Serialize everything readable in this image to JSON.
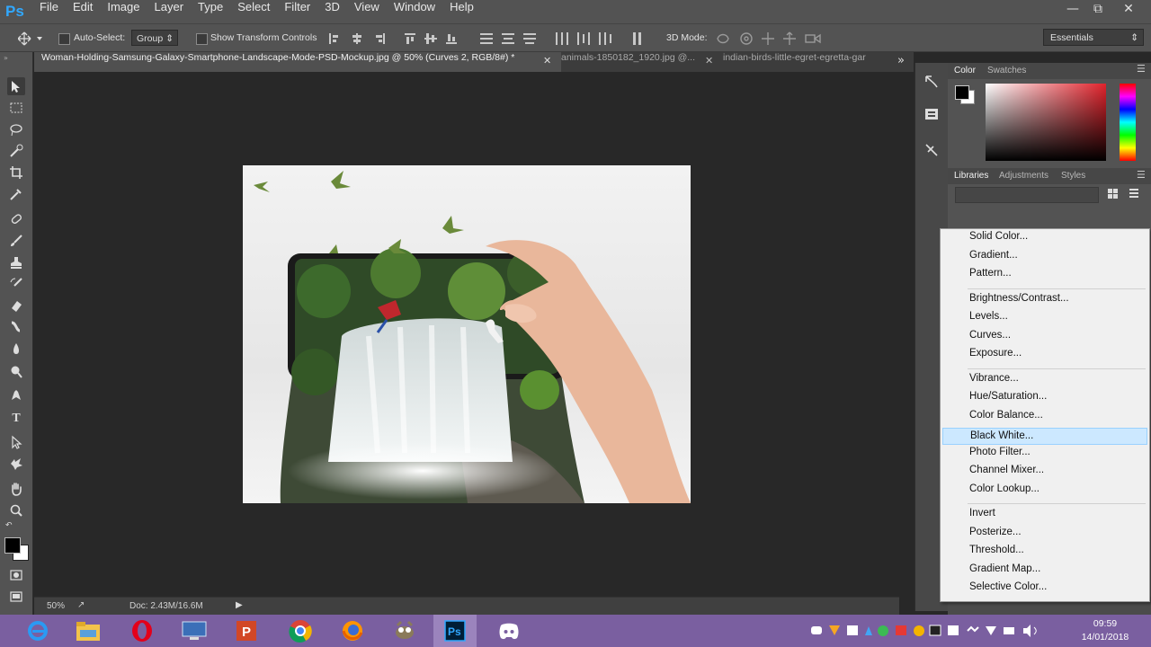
{
  "app": {
    "logo": "Ps",
    "accent": "#31a8ff"
  },
  "window_controls": {
    "minimize": "—",
    "restore": "⧉",
    "close": "✕"
  },
  "menu": [
    "File",
    "Edit",
    "Image",
    "Layer",
    "Type",
    "Select",
    "Filter",
    "3D",
    "View",
    "Window",
    "Help"
  ],
  "options_bar": {
    "auto_select_label": "Auto-Select:",
    "auto_select_value": "Group",
    "transform_label": "Show Transform Controls",
    "mode_label": "3D Mode:",
    "workspace": "Essentials"
  },
  "tabs": [
    {
      "label": "Woman-Holding-Samsung-Galaxy-Smartphone-Landscape-Mode-PSD-Mockup.jpg @ 50% (Curves 2, RGB/8#) *",
      "active": true
    },
    {
      "label": "animals-1850182_1920.jpg @...",
      "active": false
    },
    {
      "label": "indian-birds-little-egret-egretta-gar",
      "active": false
    }
  ],
  "tabs_overflow": "»",
  "status": {
    "zoom": "50%",
    "doc": "Doc: 2.43M/16.6M"
  },
  "panels": {
    "color_tabs": [
      "Color",
      "Swatches"
    ],
    "lib_tabs": [
      "Libraries",
      "Adjustments",
      "Styles"
    ]
  },
  "adjustment_menu": {
    "groups": [
      [
        "Solid Color...",
        "Gradient...",
        "Pattern..."
      ],
      [
        "Brightness/Contrast...",
        "Levels...",
        "Curves...",
        "Exposure..."
      ],
      [
        "Vibrance...",
        "Hue/Saturation...",
        "Color Balance...",
        "Black  White...",
        "Photo Filter...",
        "Channel Mixer...",
        "Color Lookup..."
      ],
      [
        "Invert",
        "Posterize...",
        "Threshold...",
        "Gradient Map...",
        "Selective Color..."
      ]
    ],
    "highlighted": "Black  White...",
    "highlight_color": "#cce8ff"
  },
  "taskbar": {
    "apps": [
      "ie-icon",
      "file-explorer-icon",
      "opera-icon",
      "control-panel-icon",
      "powerpoint-icon",
      "chrome-icon",
      "firefox-icon",
      "gimp-icon",
      "photoshop-icon",
      "discord-icon"
    ],
    "active_app": "photoshop-icon",
    "ps_label": "Ps",
    "time": "09:59",
    "date": "14/01/2018",
    "background": "#7a5fa0"
  }
}
